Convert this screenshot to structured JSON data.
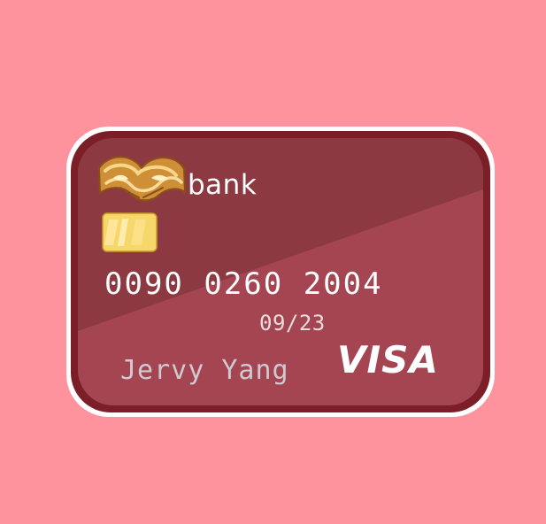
{
  "card": {
    "bank_name": "bank",
    "number": "0090 0260 2004",
    "expiry": "09/23",
    "holder_name": "Jervy Yang",
    "network": "VISA"
  },
  "icons": {
    "bank_logo": "golden-swirl-logo-icon",
    "chip": "chip-icon"
  },
  "colors": {
    "background": "#ff939d",
    "card_outer_outline": "#ffffff",
    "card_frame": "#7b1e28",
    "card_upper": "#8d3942",
    "card_lower": "#a54552",
    "chip": "#f5d76a",
    "text_primary": "#ffffff",
    "holder_text": "#cfc9d2"
  }
}
